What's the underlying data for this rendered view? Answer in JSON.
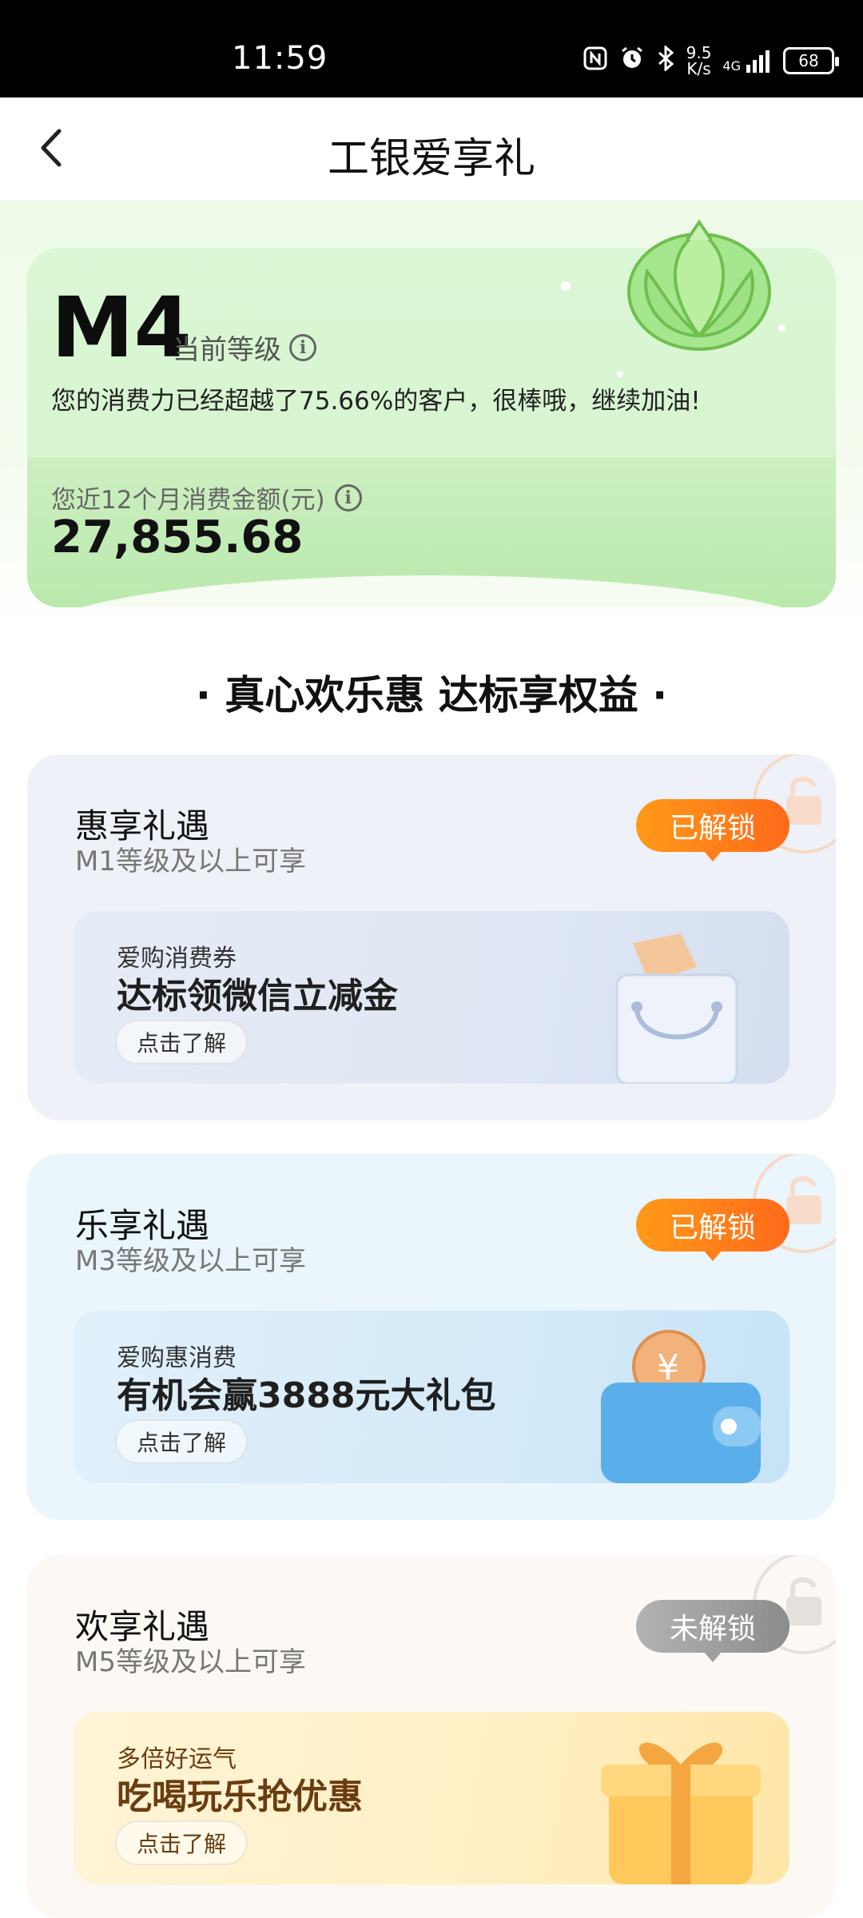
{
  "status_bar": {
    "time": "11:59",
    "icons": [
      "nfc-icon",
      "alarm-icon",
      "bluetooth-icon"
    ],
    "net_speed_value": "9.5",
    "net_speed_unit": "K/s",
    "network": "4G",
    "battery": "68"
  },
  "header": {
    "title": "工银爱享礼"
  },
  "level_card": {
    "level": "M4",
    "level_caption": "当前等级",
    "description": "您的消费力已经超越了75.66%的客户，很棒哦，继续加油!",
    "spend_label": "您近12个月消费金额(元)",
    "spend_amount": "27,855.68"
  },
  "section": {
    "title": "· 真心欢乐惠 达标享权益 ·"
  },
  "benefits": [
    {
      "name": "惠享礼遇",
      "requirement": "M1等级及以上可享",
      "status": "已解锁",
      "offer_category": "爱购消费券",
      "offer_title": "达标领微信立减金",
      "offer_button": "点击了解"
    },
    {
      "name": "乐享礼遇",
      "requirement": "M3等级及以上可享",
      "status": "已解锁",
      "offer_category": "爱购惠消费",
      "offer_title": "有机会赢3888元大礼包",
      "offer_button": "点击了解"
    },
    {
      "name": "欢享礼遇",
      "requirement": "M5等级及以上可享",
      "status": "未解锁",
      "offer_category": "多倍好运气",
      "offer_title": "吃喝玩乐抢优惠",
      "offer_button": "点击了解"
    }
  ],
  "colors": {
    "unlocked": "#ff7f1a",
    "locked": "#9e9e9e",
    "hero_green": "#d3f3cc"
  }
}
